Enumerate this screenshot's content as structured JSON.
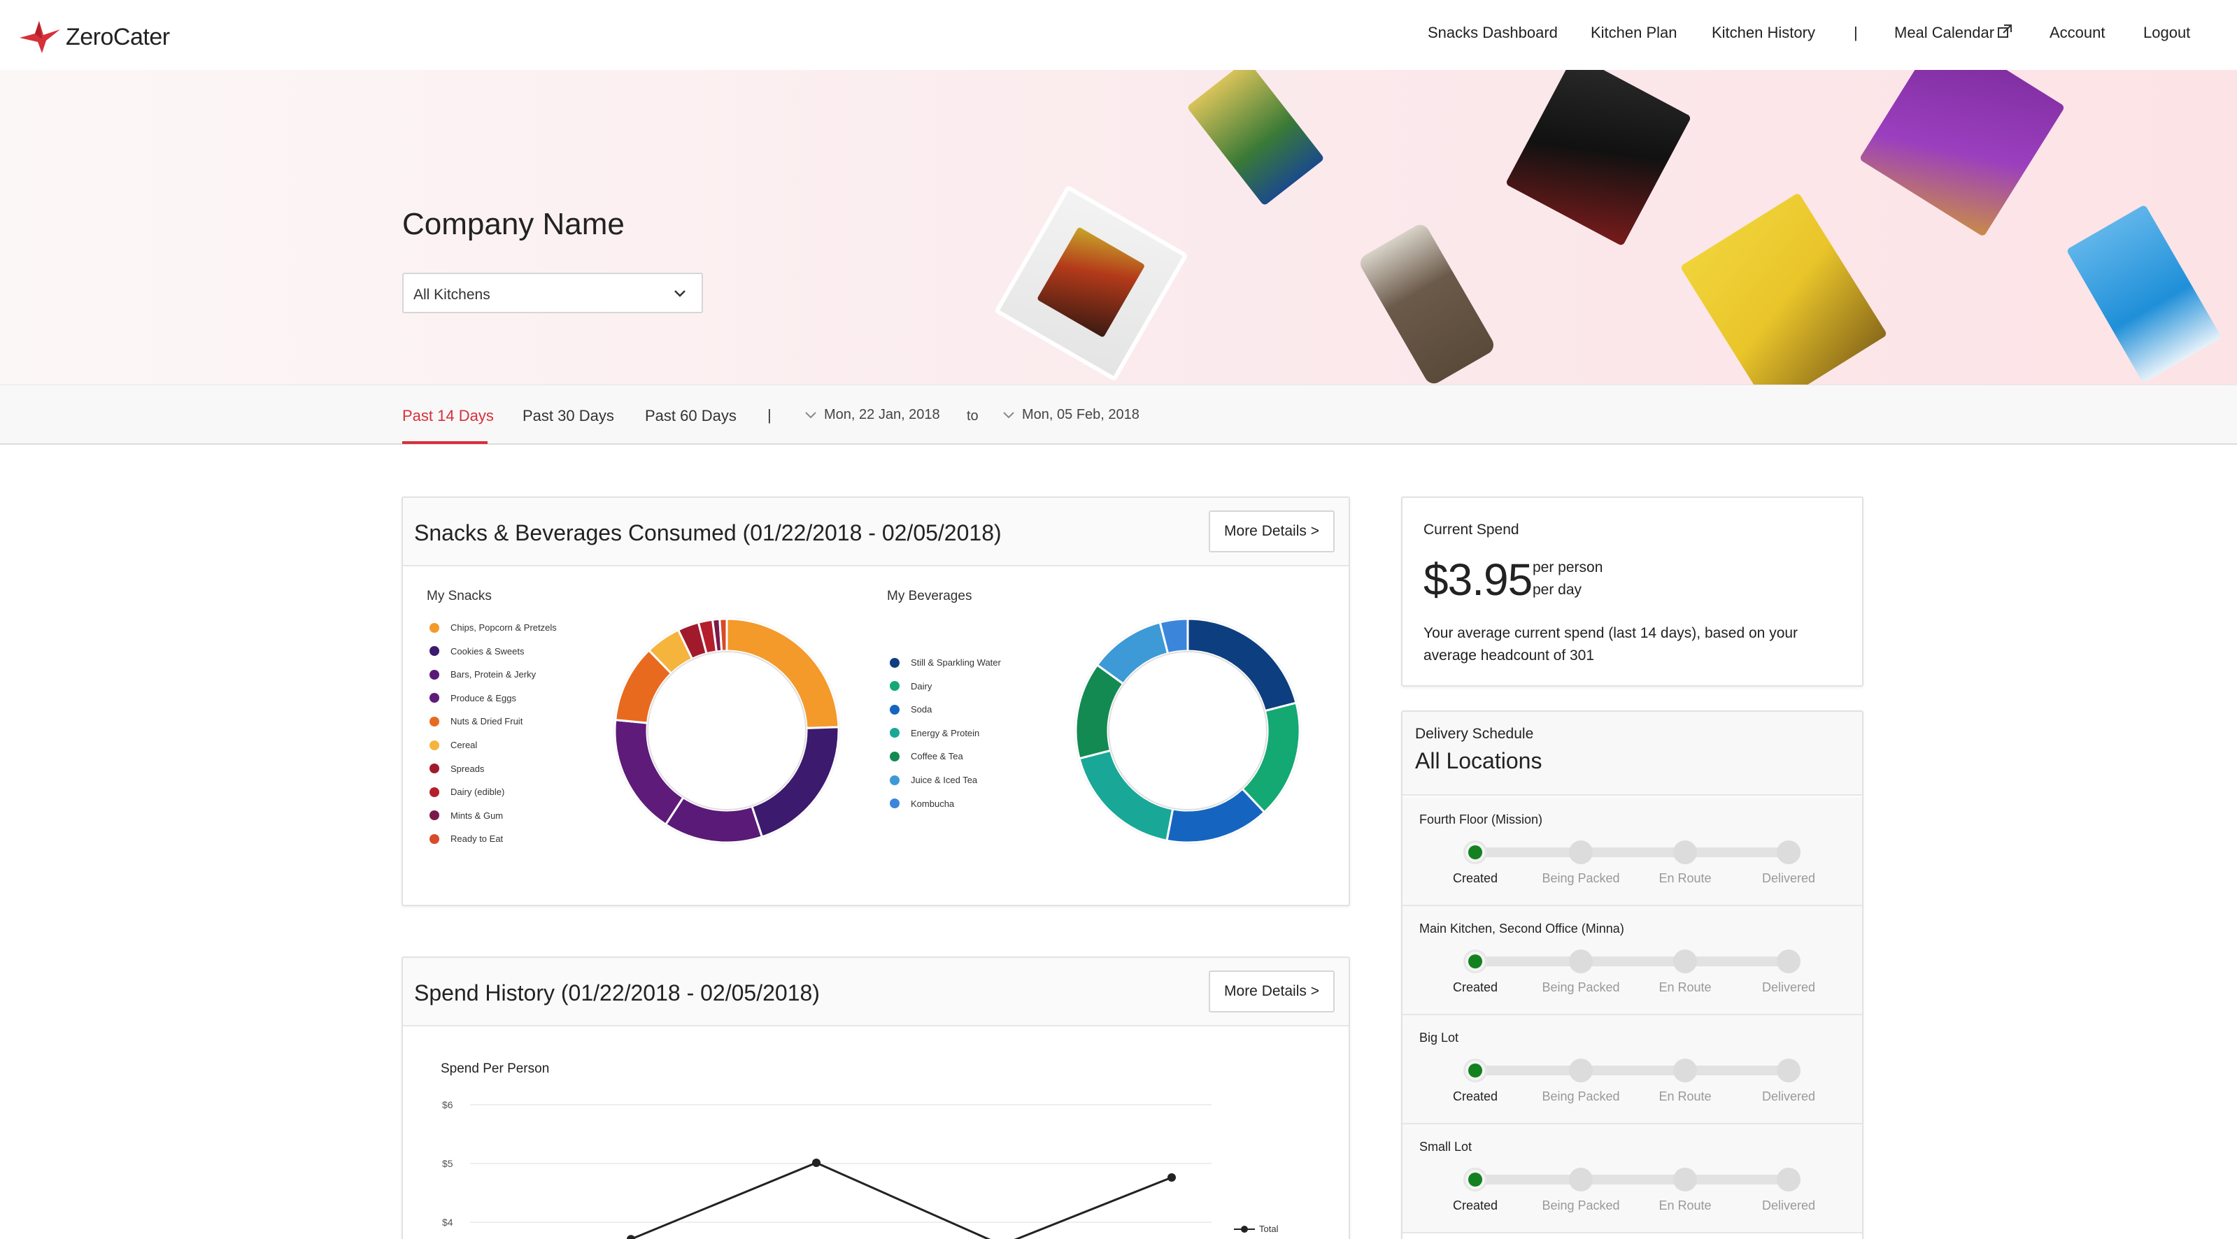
{
  "brand": {
    "name": "ZeroCater",
    "accent": "#d6303a"
  },
  "nav": {
    "snacks_dashboard": "Snacks Dashboard",
    "kitchen_plan": "Kitchen Plan",
    "kitchen_history": "Kitchen History",
    "separator": "|",
    "meal_calendar": "Meal Calendar",
    "account": "Account",
    "logout": "Logout"
  },
  "hero": {
    "company_name": "Company Name",
    "kitchen_select": "All Kitchens"
  },
  "date_filter": {
    "tabs": [
      "Past 14 Days",
      "Past 30 Days",
      "Past 60 Days"
    ],
    "active_tab": "Past 14 Days",
    "separator": "|",
    "from": "Mon, 22 Jan, 2018",
    "to_label": "to",
    "to": "Mon, 05 Feb, 2018"
  },
  "consumed": {
    "title": "Snacks & Beverages Consumed (01/22/2018 - 02/05/2018)",
    "more_details": "More Details >",
    "snacks_title": "My Snacks",
    "beverages_title": "My Beverages",
    "snacks": [
      {
        "label": "Chips, Popcorn & Pretzels",
        "color": "#f39a2b",
        "value": 24
      },
      {
        "label": "Cookies & Sweets",
        "color": "#3c1a6e",
        "value": 20
      },
      {
        "label": "Bars, Protein & Jerky",
        "color": "#5a1a78",
        "value": 14
      },
      {
        "label": "Produce & Eggs",
        "color": "#5e1b7a",
        "value": 17
      },
      {
        "label": "Nuts & Dried Fruit",
        "color": "#e86a1f",
        "value": 11
      },
      {
        "label": "Cereal",
        "color": "#f5b43c",
        "value": 5
      },
      {
        "label": "Spreads",
        "color": "#a01a2c",
        "value": 3
      },
      {
        "label": "Dairy (edible)",
        "color": "#b51f2b",
        "value": 2
      },
      {
        "label": "Mints & Gum",
        "color": "#7a1a4a",
        "value": 1
      },
      {
        "label": "Ready to Eat",
        "color": "#d94a2a",
        "value": 1
      }
    ],
    "beverages": [
      {
        "label": "Still & Sparkling Water",
        "color": "#0d3f80",
        "value": 21
      },
      {
        "label": "Dairy",
        "color": "#14a873",
        "value": 17
      },
      {
        "label": "Soda",
        "color": "#1565c0",
        "value": 15
      },
      {
        "label": "Energy & Protein",
        "color": "#19a897",
        "value": 18
      },
      {
        "label": "Coffee & Tea",
        "color": "#138a52",
        "value": 14
      },
      {
        "label": "Juice & Iced Tea",
        "color": "#3d9ad6",
        "value": 11
      },
      {
        "label": "Kombucha",
        "color": "#3b86db",
        "value": 4
      }
    ]
  },
  "current_spend": {
    "label": "Current Spend",
    "amount": "$3.95",
    "unit_line1": "per person",
    "unit_line2": "per day",
    "description": "Your average current spend (last 14 days), based on your average headcount of 301"
  },
  "delivery": {
    "label": "Delivery Schedule",
    "location": "All Locations",
    "steps": [
      "Created",
      "Being Packed",
      "En Route",
      "Delivered"
    ],
    "rows": [
      {
        "name": "Fourth Floor (Mission)",
        "status": "Created"
      },
      {
        "name": "Main Kitchen, Second Office (Minna)",
        "status": "Created"
      },
      {
        "name": "Big Lot",
        "status": "Created"
      },
      {
        "name": "Small Lot",
        "status": "Created"
      }
    ]
  },
  "spend_history": {
    "title": "Spend History (01/22/2018 - 02/05/2018)",
    "more_details": "More Details >",
    "chart_title": "Spend Per Person",
    "legend": "Total"
  },
  "chart_data": {
    "type": "line",
    "title": "Spend Per Person",
    "y_ticks": [
      "$6",
      "$5",
      "$4"
    ],
    "ylim": [
      4,
      6
    ],
    "series": [
      {
        "name": "Total",
        "points": [
          {
            "x": 1,
            "y": 3.7
          },
          {
            "x": 2,
            "y": 5.0
          },
          {
            "x": 3,
            "y": 3.6
          },
          {
            "x": 4,
            "y": 4.75
          }
        ]
      }
    ]
  }
}
